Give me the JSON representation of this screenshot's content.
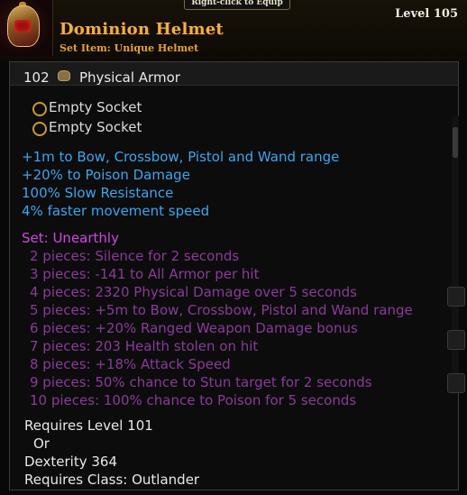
{
  "hint": "Right-click to Equip",
  "item": {
    "name": "Dominion Helmet",
    "subtitle": "Set Item: Unique Helmet",
    "level": "Level 105",
    "icon": "helmet-icon"
  },
  "armor": {
    "value": "102",
    "label": "Physical Armor",
    "icon": "armor-icon"
  },
  "sockets": [
    "Empty Socket",
    "Empty Socket"
  ],
  "modifiers": [
    "+1m to Bow, Crossbow, Pistol and Wand range",
    "+20% to Poison Damage",
    "100% Slow Resistance",
    "4% faster movement speed"
  ],
  "set": {
    "title": "Set: Unearthly",
    "pieces": [
      "2 pieces: Silence for 2 seconds",
      "3 pieces: -141 to All Armor per hit",
      "4 pieces: 2320 Physical Damage over 5 seconds",
      "5 pieces: +5m to Bow, Crossbow, Pistol and Wand range",
      "6 pieces: +20% Ranged Weapon Damage bonus",
      "7 pieces: 203 Health stolen on hit",
      "8 pieces: +18% Attack Speed",
      "9 pieces: 50% chance to Stun target for 2 seconds",
      "10 pieces: 100% chance to Poison for 5 seconds"
    ]
  },
  "requirements": {
    "level": "Requires Level 101",
    "or": "Or",
    "stat": "Dexterity 364",
    "class": "Requires Class: Outlander"
  },
  "colors": {
    "name": "#f0b040",
    "modifier": "#3aa6f0",
    "set_title": "#d046e6",
    "set_piece": "#8a3a9a",
    "socket_ring": "#c99a2a"
  }
}
